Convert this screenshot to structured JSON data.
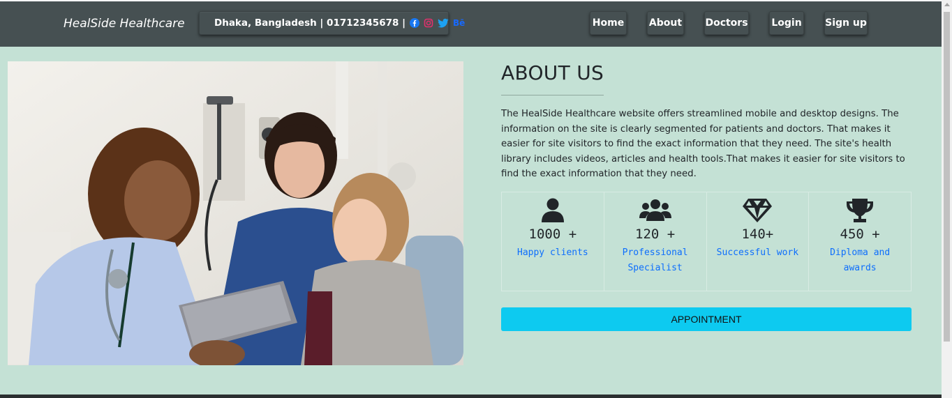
{
  "navbar": {
    "brand": "HealSide Healthcare",
    "contact": "Dhaka, Bangladesh | 01712345678 |",
    "social_icons": [
      "facebook-icon",
      "instagram-icon",
      "twitter-icon",
      "behance-icon"
    ],
    "behance_text": "Bē",
    "links": [
      "Home",
      "About",
      "Doctors",
      "Login",
      "Sign up"
    ]
  },
  "about": {
    "title": "ABOUT US",
    "text": "The HealSide Healthcare website offers streamlined mobile and desktop designs. The information on the site is clearly segmented for patients and doctors. That makes it easier for site visitors to find the exact information that they need. The site's health library includes videos, articles and health tools.That makes it easier for site visitors to find the exact information that they need."
  },
  "stats": [
    {
      "icon": "user-icon",
      "value": "1000 +",
      "label": "Happy clients"
    },
    {
      "icon": "users-icon",
      "value": "120 +",
      "label": "Professional Specialist"
    },
    {
      "icon": "gem-icon",
      "value": "140+",
      "label": "Successful work"
    },
    {
      "icon": "trophy-icon",
      "value": "450 +",
      "label": "Diploma and awards"
    }
  ],
  "appointment_button": "APPOINTMENT",
  "colors": {
    "navbar": "#465052",
    "background": "#c4e1d5",
    "link": "#0d6efd",
    "button": "#0dcaf0"
  }
}
